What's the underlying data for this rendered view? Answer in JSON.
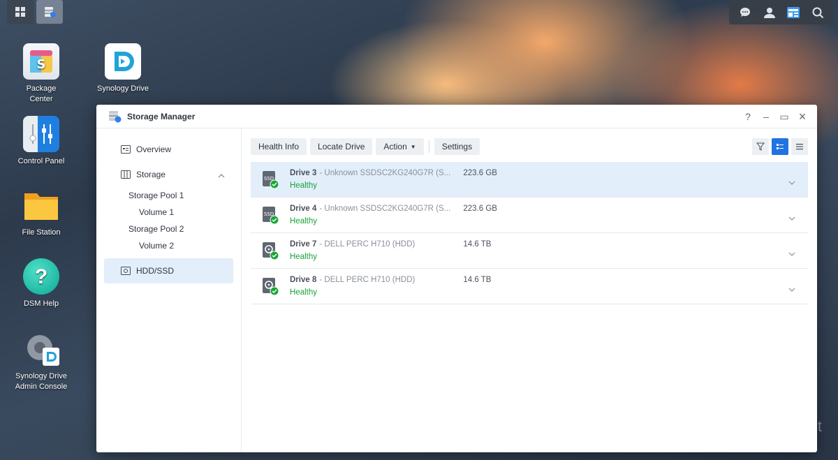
{
  "desktop": {
    "icons": [
      {
        "label_line1": "Package",
        "label_line2": "Center"
      },
      {
        "label_line1": "Synology Drive",
        "label_line2": ""
      },
      {
        "label_line1": "Control Panel",
        "label_line2": ""
      },
      {
        "label_line1": "File Station",
        "label_line2": ""
      },
      {
        "label_line1": "DSM Help",
        "label_line2": ""
      },
      {
        "label_line1": "Synology Drive",
        "label_line2": "Admin Console"
      }
    ],
    "watermark": "skelbiu.lt"
  },
  "window": {
    "title": "Storage Manager",
    "controls": {
      "help": "?",
      "minimize": "–",
      "maximize": "▭",
      "close": "×"
    }
  },
  "sidebar": {
    "overview": "Overview",
    "storage": "Storage",
    "pool1": "Storage Pool 1",
    "volume1": "Volume 1",
    "pool2": "Storage Pool 2",
    "volume2": "Volume 2",
    "hddssd": "HDD/SSD"
  },
  "toolbar": {
    "health_info": "Health Info",
    "locate_drive": "Locate Drive",
    "action": "Action",
    "settings": "Settings"
  },
  "drives": [
    {
      "name": "Drive 3",
      "model": " - Unknown SSDSC2KG240G7R (S...",
      "size": "223.6 GB",
      "status": "Healthy",
      "type": "SSD"
    },
    {
      "name": "Drive 4",
      "model": " - Unknown SSDSC2KG240G7R (S...",
      "size": "223.6 GB",
      "status": "Healthy",
      "type": "SSD"
    },
    {
      "name": "Drive 7",
      "model": " - DELL PERC H710 (HDD)",
      "size": "14.6 TB",
      "status": "Healthy",
      "type": "HDD"
    },
    {
      "name": "Drive 8",
      "model": " - DELL PERC H710 (HDD)",
      "size": "14.6 TB",
      "status": "Healthy",
      "type": "HDD"
    }
  ],
  "colors": {
    "accent": "#1f74e0",
    "healthy": "#18a33a",
    "selected_row": "#e3eefb"
  }
}
